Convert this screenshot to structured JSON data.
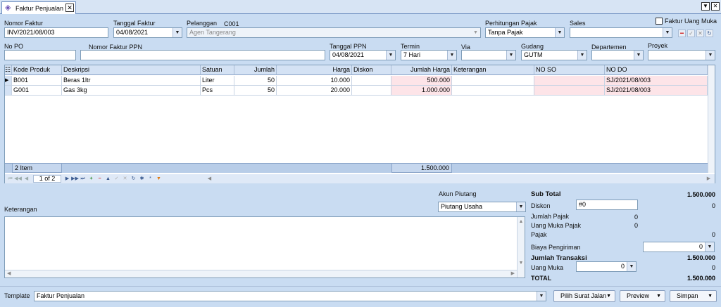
{
  "tab": {
    "title": "Faktur Penjualan"
  },
  "header": {
    "nomor_faktur_label": "Nomor Faktur",
    "nomor_faktur": "INV/2021/08/003",
    "tanggal_faktur_label": "Tanggal Faktur",
    "tanggal_faktur": "04/08/2021",
    "pelanggan_label": "Pelanggan",
    "pelanggan_kode": "C001",
    "pelanggan_nama": "Agen Tangerang",
    "perhitungan_pajak_label": "Perhitungan Pajak",
    "perhitungan_pajak": "Tanpa Pajak",
    "sales_label": "Sales",
    "sales": "",
    "faktur_uang_muka_label": "Faktur Uang Muka",
    "no_po_label": "No PO",
    "no_po": "",
    "nomor_faktur_ppn_label": "Nomor Faktur PPN",
    "nomor_faktur_ppn": "",
    "tanggal_ppn_label": "Tanggal PPN",
    "tanggal_ppn": "04/08/2021",
    "termin_label": "Termin",
    "termin": "7 Hari",
    "via_label": "Via",
    "via": "",
    "gudang_label": "Gudang",
    "gudang": "GUTM",
    "departemen_label": "Departemen",
    "departemen": "",
    "proyek_label": "Proyek",
    "proyek": ""
  },
  "grid": {
    "columns": [
      "Kode Produk",
      "Deskripsi",
      "Satuan",
      "Jumlah",
      "Harga",
      "Diskon",
      "Jumlah Harga",
      "Keterangan",
      "NO SO",
      "NO DO"
    ],
    "rows": [
      {
        "kode": "B001",
        "deskripsi": "Beras 1ltr",
        "satuan": "Liter",
        "jumlah": "50",
        "harga": "10.000",
        "diskon": "",
        "jumlah_harga": "500.000",
        "keterangan": "",
        "no_so": "",
        "no_do": "SJ/2021/08/003"
      },
      {
        "kode": "G001",
        "deskripsi": "Gas 3kg",
        "satuan": "Pcs",
        "jumlah": "50",
        "harga": "20.000",
        "diskon": "",
        "jumlah_harga": "1.000.000",
        "keterangan": "",
        "no_so": "",
        "no_do": "SJ/2021/08/003"
      }
    ],
    "footer_count": "2 Item",
    "footer_total": "1.500.000",
    "pager": "1 of 2"
  },
  "keterangan_label": "Keterangan",
  "akun_piutang_label": "Akun Piutang",
  "akun_piutang": "Piutang Usaha",
  "summary": {
    "sub_total_label": "Sub Total",
    "sub_total": "1.500.000",
    "diskon_label": "Diskon",
    "diskon_input": "#0",
    "diskon_value": "0",
    "jumlah_pajak_label": "Jumlah Pajak",
    "jumlah_pajak": "0",
    "uang_muka_pajak_label": "Uang Muka Pajak",
    "uang_muka_pajak": "0",
    "pajak_label": "Pajak",
    "pajak": "0",
    "biaya_pengiriman_label": "Biaya Pengiriman",
    "biaya_pengiriman": "0",
    "jumlah_transaksi_label": "Jumlah Transaksi",
    "jumlah_transaksi": "1.500.000",
    "uang_muka_label": "Uang Muka",
    "uang_muka_input": "0",
    "uang_muka_value": "0",
    "total_label": "TOTAL",
    "total": "1.500.000"
  },
  "bottom": {
    "template_label": "Template",
    "template": "Faktur Penjualan",
    "pilih_surat_jalan": "Pilih Surat Jalan",
    "preview": "Preview",
    "simpan": "Simpan"
  },
  "colors": {
    "background": "#c9dcf2",
    "grid_header": "#d4e2f4",
    "highlight_pink": "#fde4e8",
    "accent_red": "#d02020"
  },
  "icons": [
    "faktur-tab-icon",
    "close-icon",
    "chevron-down-icon",
    "first-icon",
    "prev-icon",
    "next-icon",
    "last-icon",
    "add-icon",
    "delete-icon",
    "check-icon",
    "cancel-icon",
    "refresh-icon"
  ]
}
